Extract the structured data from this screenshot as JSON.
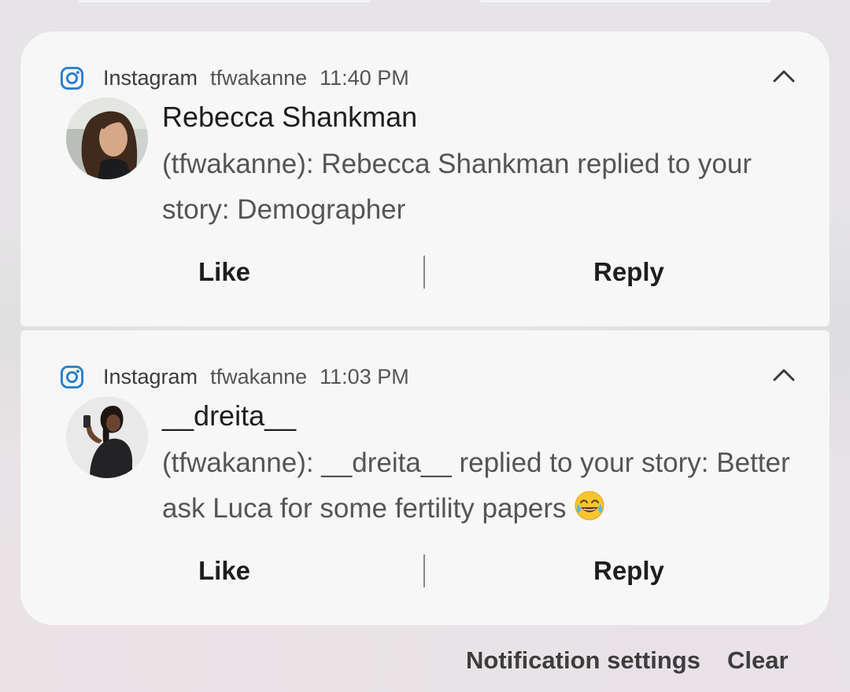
{
  "notifications": [
    {
      "app_name": "Instagram",
      "account": "tfwakanne",
      "time": "11:40 PM",
      "sender": "Rebecca Shankman",
      "message": "(tfwakanne): Rebecca Shankman replied to your story: Demographer",
      "emoji": "",
      "actions": {
        "like": "Like",
        "reply": "Reply"
      }
    },
    {
      "app_name": "Instagram",
      "account": "tfwakanne",
      "time": "11:03 PM",
      "sender": "__dreita__",
      "message": "(tfwakanne): __dreita__ replied to your story: Better ask Luca for some fertility papers",
      "emoji": "😂",
      "actions": {
        "like": "Like",
        "reply": "Reply"
      }
    }
  ],
  "footer": {
    "notification_settings": "Notification settings",
    "clear": "Clear"
  },
  "icons": {
    "app": "instagram-icon",
    "collapse": "chevron-up-icon"
  },
  "colors": {
    "instagram_blue": "#2a7fd0",
    "card_background": "#f7f7f7",
    "primary_text": "#1e1e1e",
    "secondary_text": "#555555"
  }
}
